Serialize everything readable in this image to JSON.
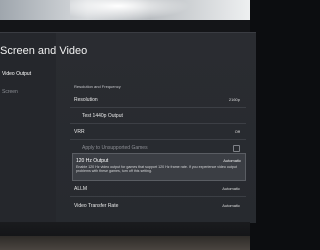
{
  "window": {
    "title": "Screen and Video"
  },
  "sidebar": {
    "items": [
      {
        "label": "Video Output"
      },
      {
        "label": "Screen"
      }
    ]
  },
  "main": {
    "section_label": "Resolution and Frequency",
    "rows": [
      {
        "label": "Resolution",
        "value": "2160p"
      },
      {
        "label": "Test 1440p Output",
        "value": ""
      },
      {
        "label": "VRR",
        "value": "Off"
      },
      {
        "label": "Apply to Unsupported Games",
        "value": ""
      },
      {
        "label": "ALLM",
        "value": "Automatic"
      },
      {
        "label": "Video Transfer Rate",
        "value": "Automatic"
      }
    ],
    "selected": {
      "label": "120 Hz Output",
      "value": "Automatic",
      "description": "Enable 120 Hz video output for games that support 120 Hz frame rate. If you experience video output problems with these games, turn off this setting."
    }
  }
}
